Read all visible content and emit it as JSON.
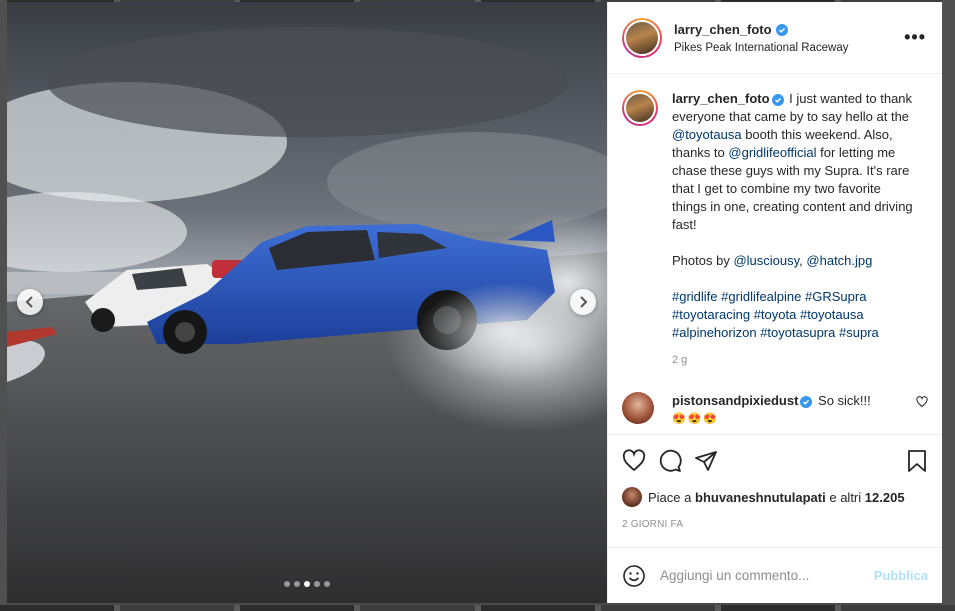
{
  "post": {
    "username": "larry_chen_foto",
    "location": "Pikes Peak International Raceway",
    "more_label": "•••"
  },
  "caption": {
    "username": "larry_chen_foto",
    "text_1": "I just wanted to thank everyone that came by to say hello at the",
    "mention_1": "@toyotausa",
    "text_2": "booth this weekend. Also, thanks to",
    "mention_2": "@gridlifeofficial",
    "text_3": "for letting me chase these guys with my Supra. It's rare that I get to combine my two favorite things in one, creating content and driving fast!",
    "photos_by": "Photos by",
    "mention_3": "@lusciousy",
    "comma": ",",
    "mention_4": "@hatch.jpg",
    "hashtags": [
      "#gridlife",
      "#gridlifealpine",
      "#GRSupra",
      "#toyotaracing",
      "#toyota",
      "#toyotausa",
      "#alpinehorizon",
      "#toyotasupra",
      "#supra"
    ],
    "time_ago": "2 g"
  },
  "comment": {
    "username": "pistonsandpixiedust",
    "text": "So sick!!!",
    "emoji": "😍😍😍"
  },
  "likes": {
    "prefix": "Piace a",
    "user": "bhuvaneshnutulapati",
    "suffix": "e altri",
    "count": "12.205"
  },
  "date": "2 GIORNI FA",
  "composer": {
    "placeholder": "Aggiungi un commento...",
    "publish_label": "Pubblica"
  },
  "carousel": {
    "dot_count": 5,
    "active_dot": 3
  },
  "icons": {
    "like": "heart-icon",
    "comment": "comment-bubble-icon",
    "share": "paper-plane-icon",
    "save": "bookmark-icon",
    "emoji": "smiley-icon",
    "prev": "chevron-left-icon",
    "next": "chevron-right-icon",
    "verified": "verified-badge-icon"
  },
  "colors": {
    "verified": "#3897f0",
    "link": "#00376b",
    "publish_disabled": "#b2dffc",
    "muted": "#8e8e8e"
  }
}
